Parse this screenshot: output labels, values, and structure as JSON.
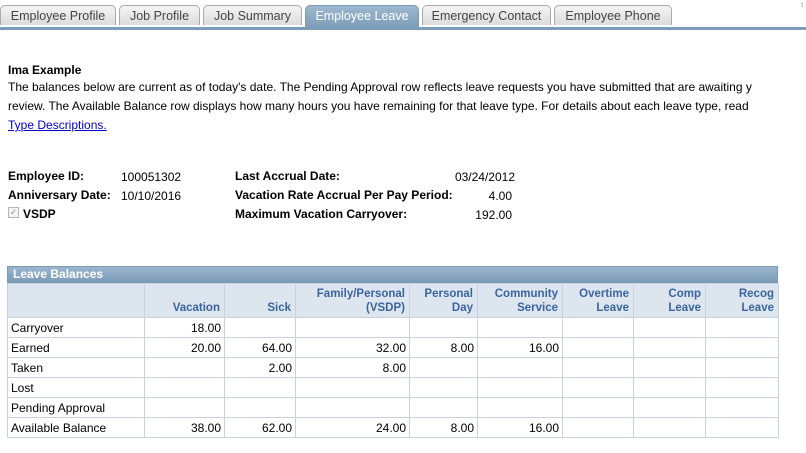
{
  "tabs": [
    "Employee Profile",
    "Job Profile",
    "Job Summary",
    "Employee Leave",
    "Emergency Contact",
    "Employee Phone"
  ],
  "active_tab": "Employee Leave",
  "employee_name": "Ima Example",
  "description": {
    "line1": "The balances below are current as of today's date. The Pending Approval row reflects leave requests you have submitted that are awaiting y",
    "line2": "review. The Available Balance row displays how many hours you have remaining for that leave type. For details about each leave type, read",
    "link": "Type Descriptions."
  },
  "info": {
    "employee_id_label": "Employee ID:",
    "employee_id": "100051302",
    "anniversary_label": "Anniversary Date:",
    "anniversary": "10/10/2016",
    "vsdp_label": "VSDP",
    "vsdp_checked": true,
    "last_accrual_label": "Last Accrual Date:",
    "last_accrual": "03/24/2012",
    "vac_rate_label": "Vacation Rate Accrual Per Pay Period:",
    "vac_rate": "4.00",
    "max_carry_label": "Maximum Vacation Carryover:",
    "max_carry": "192.00"
  },
  "grid": {
    "title": "Leave Balances",
    "headers": [
      "",
      "Vacation",
      "Sick",
      "Family/Personal (VSDP)",
      "Personal Day",
      "Community Service",
      "Overtime Leave",
      "Comp Leave",
      "Recog Leave"
    ],
    "rows": [
      [
        "Carryover",
        "18.00",
        "",
        "",
        "",
        "",
        "",
        "",
        ""
      ],
      [
        "Earned",
        "20.00",
        "64.00",
        "32.00",
        "8.00",
        "16.00",
        "",
        "",
        ""
      ],
      [
        "Taken",
        "",
        "2.00",
        "8.00",
        "",
        "",
        "",
        "",
        ""
      ],
      [
        "Lost",
        "",
        "",
        "",
        "",
        "",
        "",
        "",
        ""
      ],
      [
        "Pending Approval",
        "",
        "",
        "",
        "",
        "",
        "",
        "",
        ""
      ],
      [
        "Available Balance",
        "38.00",
        "62.00",
        "24.00",
        "8.00",
        "16.00",
        "",
        "",
        ""
      ]
    ]
  },
  "colors": {
    "tab_active": "#7d9cb7",
    "header_text": "#3a64a0",
    "link": "#0000cc"
  }
}
